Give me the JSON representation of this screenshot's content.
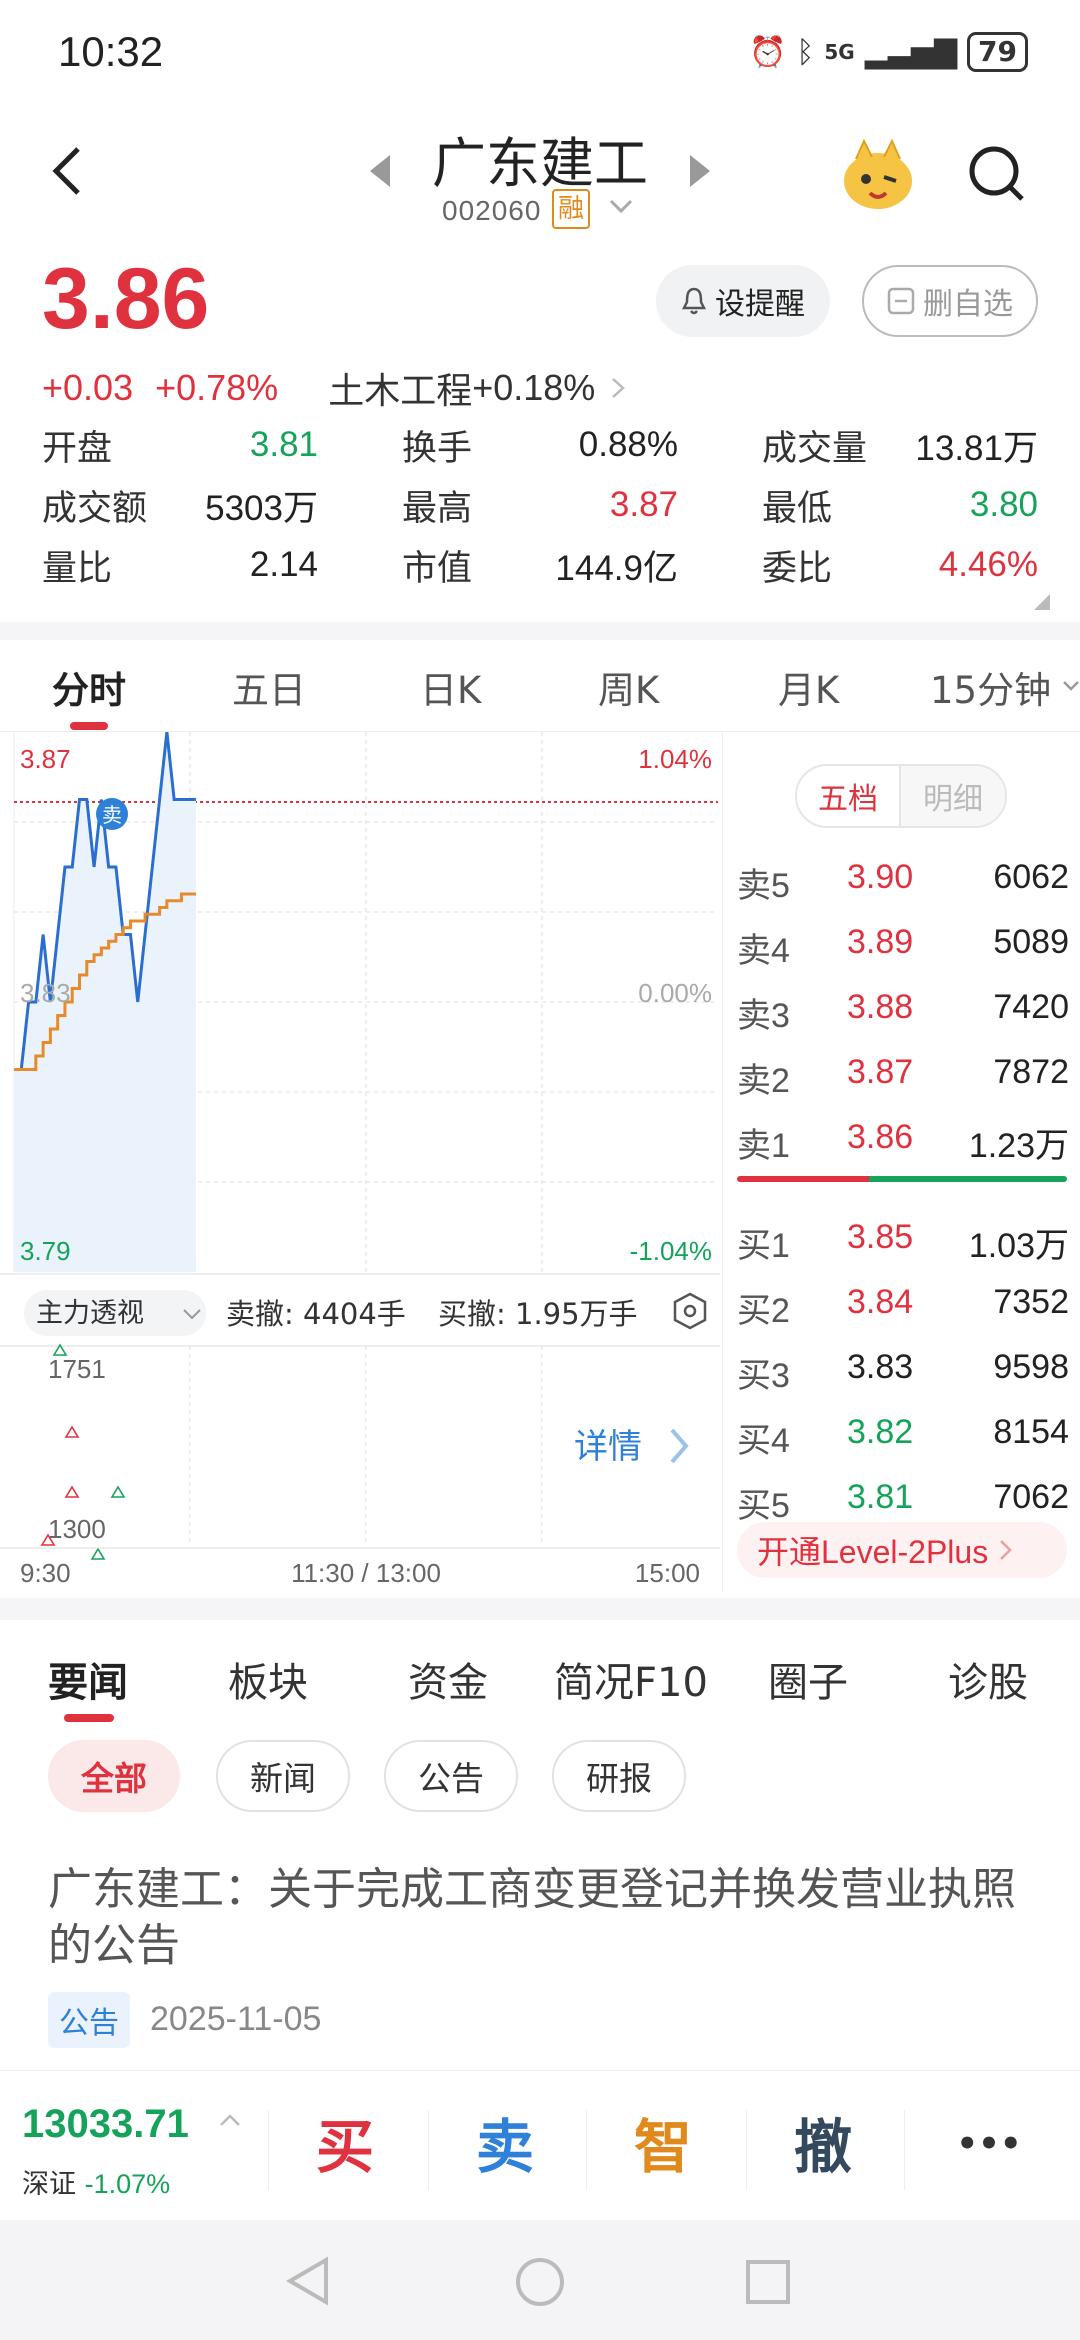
{
  "status": {
    "time": "10:32",
    "network": "5G",
    "battery": "79"
  },
  "header": {
    "name": "广东建工",
    "code": "002060",
    "margin_badge": "融"
  },
  "quote": {
    "price": "3.86",
    "change": "+0.03",
    "change_pct": "+0.78%",
    "sector": "土木工程",
    "sector_pct": "+0.18%",
    "remind_label": "设提醒",
    "unfav_label": "删自选",
    "stats": [
      {
        "k": "开盘",
        "v": "3.81",
        "c": "green"
      },
      {
        "k": "换手",
        "v": "0.88%",
        "c": "dark"
      },
      {
        "k": "成交量",
        "v": "13.81万",
        "c": "dark"
      },
      {
        "k": "成交额",
        "v": "5303万",
        "c": "dark"
      },
      {
        "k": "最高",
        "v": "3.87",
        "c": "red"
      },
      {
        "k": "最低",
        "v": "3.80",
        "c": "green"
      },
      {
        "k": "量比",
        "v": "2.14",
        "c": "dark"
      },
      {
        "k": "市值",
        "v": "144.9亿",
        "c": "dark"
      },
      {
        "k": "委比",
        "v": "4.46%",
        "c": "red"
      }
    ]
  },
  "kline_tabs": [
    "分时",
    "五日",
    "日K",
    "周K",
    "月K",
    "15分钟"
  ],
  "chart": {
    "price_high": "3.87",
    "price_mid": "3.83",
    "price_low": "3.79",
    "pct_high": "1.04%",
    "pct_mid": "0.00%",
    "pct_low": "-1.04%",
    "sell_marker": "卖",
    "indicator": "主力透视",
    "sell_cancel": "卖撤: 4404手",
    "buy_cancel": "买撤: 1.95万手",
    "vol_high": "1751",
    "vol_low": "1300",
    "detail": "详情",
    "time_start": "9:30",
    "time_mid": "11:30 / 13:00",
    "time_end": "15:00"
  },
  "chart_data": {
    "type": "line",
    "title": "",
    "ylim": [
      3.79,
      3.87
    ],
    "series": [
      {
        "values": [
          3.82,
          3.82,
          3.83,
          3.83,
          3.84,
          3.83,
          3.84,
          3.85,
          3.85,
          3.86,
          3.86,
          3.85,
          3.86,
          3.85,
          3.85,
          3.84,
          3.84,
          3.83,
          3.84,
          3.85,
          3.86,
          3.87,
          3.86,
          3.86,
          3.86,
          3.86
        ]
      },
      {
        "values": [
          3.82,
          3.82,
          3.82,
          3.822,
          3.824,
          3.826,
          3.828,
          3.83,
          3.832,
          3.834,
          3.836,
          3.837,
          3.838,
          3.839,
          3.84,
          3.841,
          3.842,
          3.842,
          3.843,
          3.843,
          3.844,
          3.845,
          3.845,
          3.846,
          3.846,
          3.846
        ]
      }
    ]
  },
  "orderbook": {
    "tab_active": "五档",
    "tab_other": "明细",
    "asks": [
      {
        "l": "卖5",
        "p": "3.90",
        "v": "6062",
        "c": "red"
      },
      {
        "l": "卖4",
        "p": "3.89",
        "v": "5089",
        "c": "red"
      },
      {
        "l": "卖3",
        "p": "3.88",
        "v": "7420",
        "c": "red"
      },
      {
        "l": "卖2",
        "p": "3.87",
        "v": "7872",
        "c": "red"
      },
      {
        "l": "卖1",
        "p": "3.86",
        "v": "1.23万",
        "c": "red"
      }
    ],
    "bids": [
      {
        "l": "买1",
        "p": "3.85",
        "v": "1.03万",
        "c": "red"
      },
      {
        "l": "买2",
        "p": "3.84",
        "v": "7352",
        "c": "red"
      },
      {
        "l": "买3",
        "p": "3.83",
        "v": "9598",
        "c": "dark"
      },
      {
        "l": "买4",
        "p": "3.82",
        "v": "8154",
        "c": "green"
      },
      {
        "l": "买5",
        "p": "3.81",
        "v": "7062",
        "c": "green"
      }
    ],
    "level2": "开通Level-2Plus"
  },
  "news_tabs": [
    "要闻",
    "板块",
    "资金",
    "简况F10",
    "圈子",
    "诊股"
  ],
  "news_chips": [
    "全部",
    "新闻",
    "公告",
    "研报"
  ],
  "news": {
    "title": "广东建工：关于完成工商变更登记并换发营业执照的公告",
    "tag": "公告",
    "date": "2025-11-05"
  },
  "bottom": {
    "index_value": "13033.71",
    "index_name": "深证",
    "index_pct": "-1.07%",
    "actions": [
      "买",
      "卖",
      "智",
      "撤"
    ],
    "more": "•••"
  }
}
